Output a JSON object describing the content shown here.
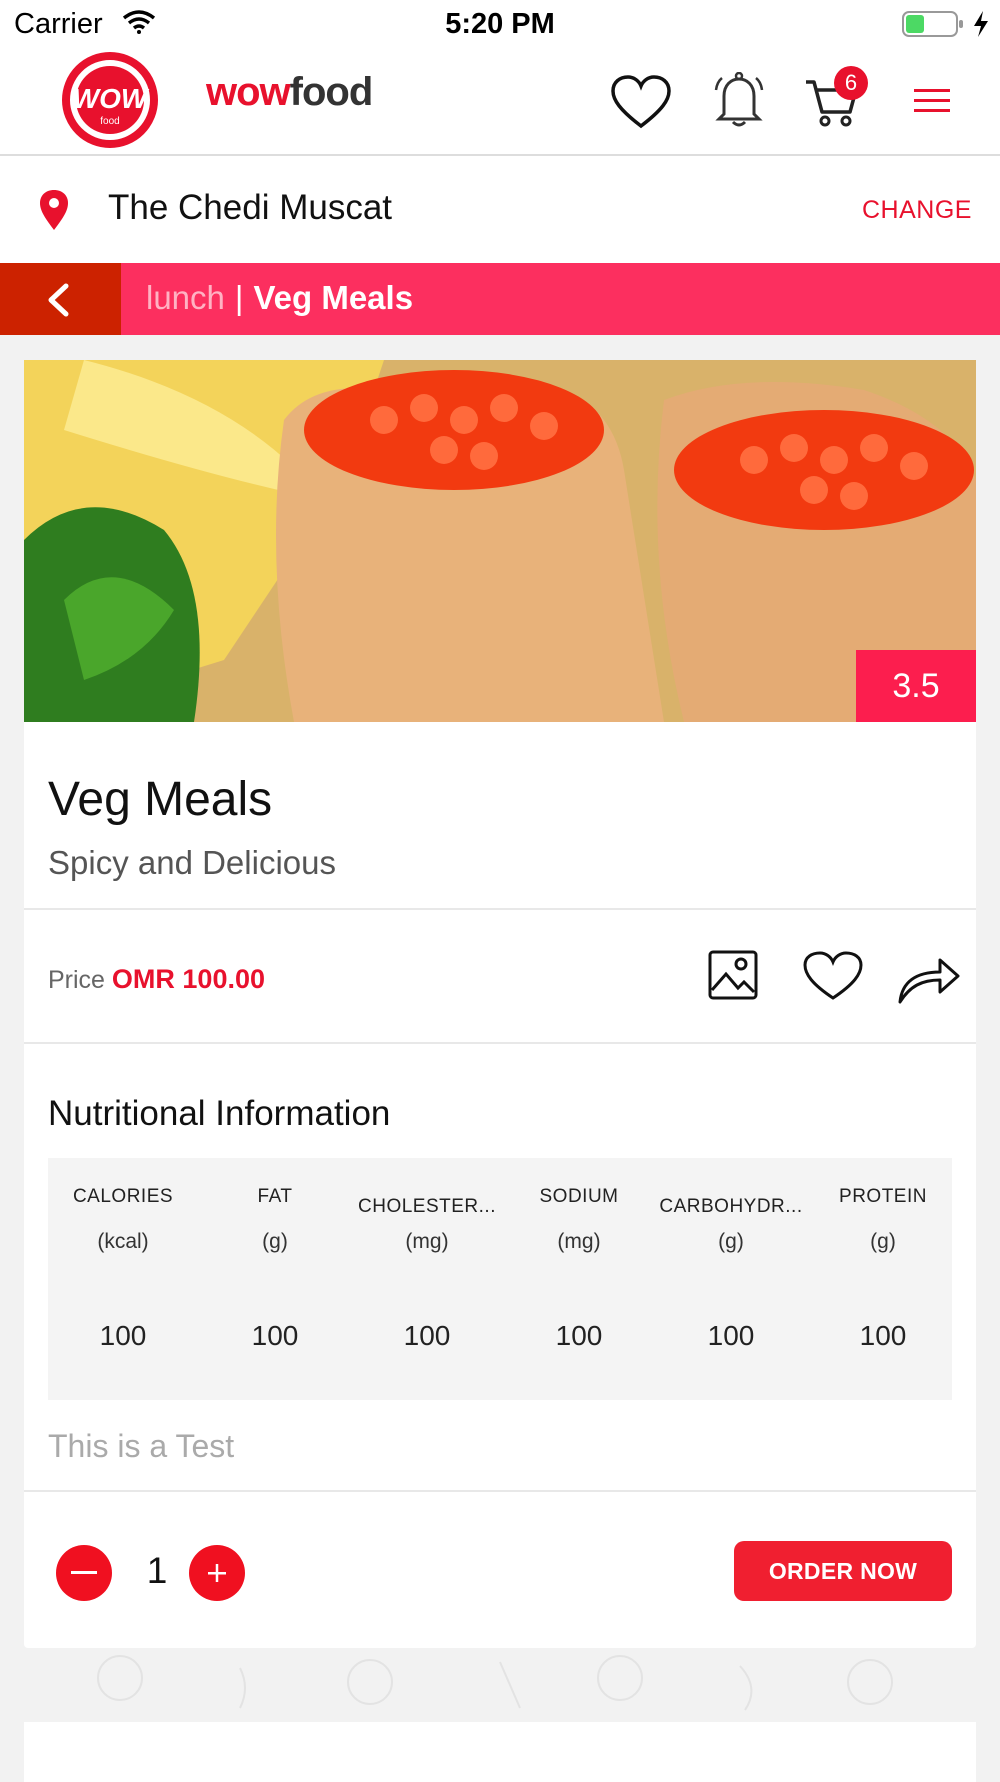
{
  "status_bar": {
    "carrier": "Carrier",
    "time": "5:20 PM"
  },
  "header": {
    "logo_text": "WOW",
    "logo_subtext": "food",
    "brand_wow": "wow",
    "brand_food": "food",
    "cart_count": "6",
    "icons": [
      "heart-icon",
      "bell-icon",
      "cart-icon",
      "menu-icon"
    ]
  },
  "location": {
    "name": "The Chedi Muscat",
    "change_label": "CHANGE"
  },
  "breadcrumb": {
    "parent": "lunch",
    "separator": "|",
    "current": "Veg Meals"
  },
  "item": {
    "rating": "3.5",
    "title": "Veg Meals",
    "subtitle": "Spicy and Delicious",
    "price_label": "Price",
    "price_value": "OMR 100.00"
  },
  "nutrition": {
    "title": "Nutritional Information",
    "columns": [
      {
        "name": "CALORIES",
        "unit": "(kcal)",
        "value": "100"
      },
      {
        "name": "FAT",
        "unit": "(g)",
        "value": "100"
      },
      {
        "name": "CHOLESTER...",
        "unit": "(mg)",
        "value": "100"
      },
      {
        "name": "SODIUM",
        "unit": "(mg)",
        "value": "100"
      },
      {
        "name": "CARBOHYDR...",
        "unit": "(g)",
        "value": "100"
      },
      {
        "name": "PROTEIN",
        "unit": "(g)",
        "value": "100"
      }
    ]
  },
  "note": "This is a Test",
  "order": {
    "quantity": "1",
    "button_label": "ORDER NOW"
  },
  "colors": {
    "accent": "#e8112d",
    "breadcrumb_bg": "#fc2f5f",
    "back_bg": "#cc2200"
  }
}
